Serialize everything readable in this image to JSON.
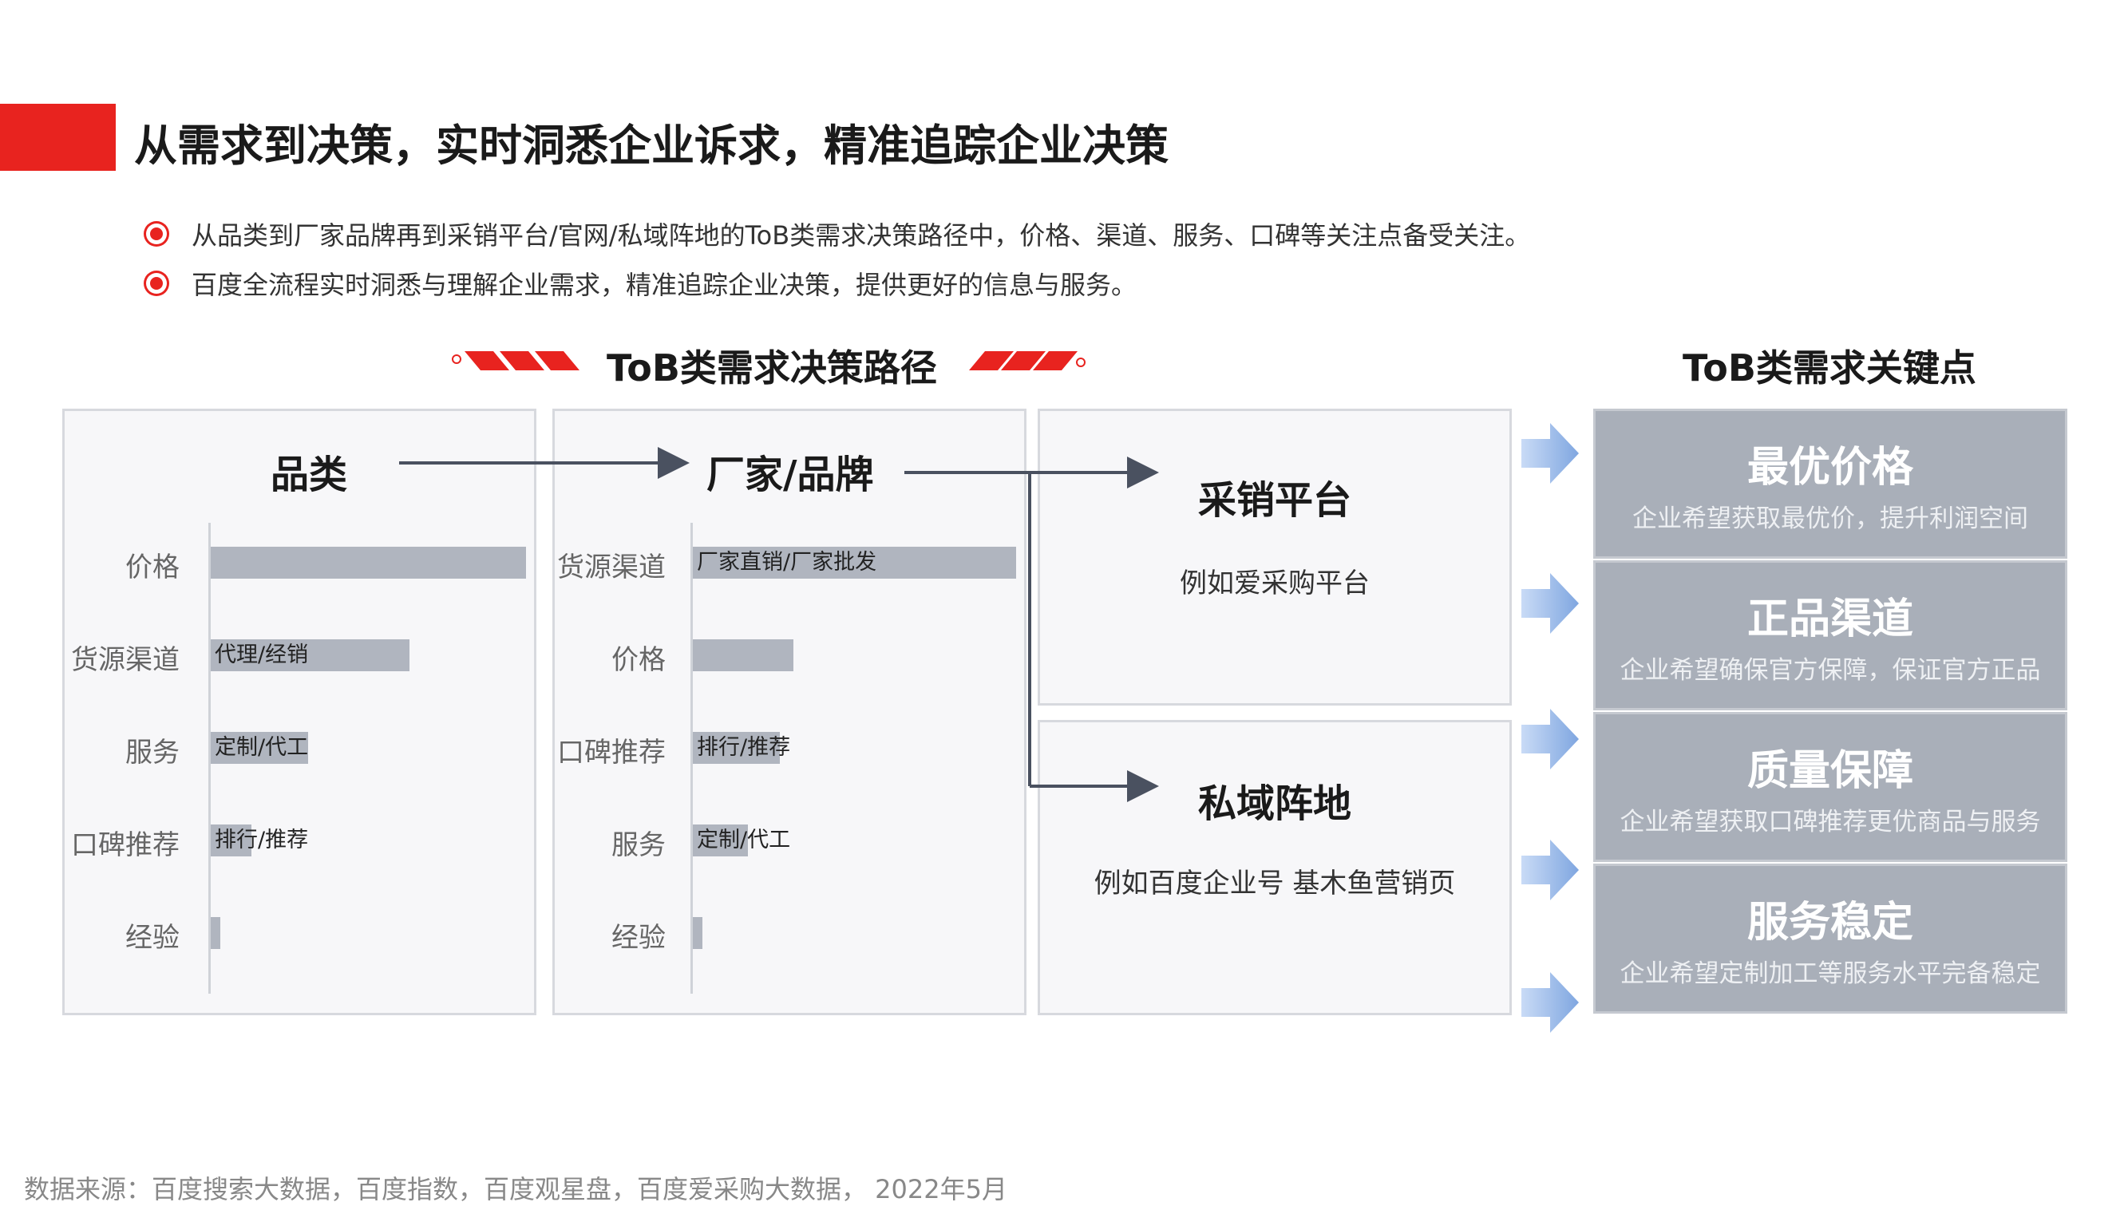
{
  "title": "从需求到决策，实时洞悉企业诉求，精准追踪企业决策",
  "bullets": [
    "从品类到厂家品牌再到采销平台/官网/私域阵地的ToB类需求决策路径中，价格、渠道、服务、口碑等关注点备受关注。",
    "百度全流程实时洞悉与理解企业需求，精准追踪企业决策，提供更好的信息与服务。"
  ],
  "path_title": "ToB类需求决策路径",
  "key_title": "ToB类需求关键点",
  "panel_category": {
    "title": "品类",
    "rows": [
      {
        "label": "价格",
        "bar_text": "",
        "value": 1.0
      },
      {
        "label": "货源渠道",
        "bar_text": "代理/经销",
        "value": 0.63
      },
      {
        "label": "服务",
        "bar_text": "定制/代工",
        "value": 0.31
      },
      {
        "label": "口碑推荐",
        "bar_text": "排行/推荐",
        "value": 0.13
      },
      {
        "label": "经验",
        "bar_text": "",
        "value": 0.03
      }
    ]
  },
  "panel_brand": {
    "title": "厂家/品牌",
    "rows": [
      {
        "label": "货源渠道",
        "bar_text": "厂家直销/厂家批发",
        "value": 1.0
      },
      {
        "label": "价格",
        "bar_text": "",
        "value": 0.31
      },
      {
        "label": "口碑推荐",
        "bar_text": "排行/推荐",
        "value": 0.27
      },
      {
        "label": "服务",
        "bar_text": "定制/代工",
        "value": 0.17
      },
      {
        "label": "经验",
        "bar_text": "",
        "value": 0.03
      }
    ]
  },
  "panel_platform": {
    "title": "采销平台",
    "subtitle": "例如爱采购平台"
  },
  "panel_private": {
    "title": "私域阵地",
    "subtitle": "例如百度企业号 基木鱼营销页"
  },
  "key_points": [
    {
      "title": "最优价格",
      "subtitle": "企业希望获取最优价，提升利润空间"
    },
    {
      "title": "正品渠道",
      "subtitle": "企业希望确保官方保障，保证官方正品"
    },
    {
      "title": "质量保障",
      "subtitle": "企业希望获取口碑推荐更优商品与服务"
    },
    {
      "title": "服务稳定",
      "subtitle": "企业希望定制加工等服务水平完备稳定"
    }
  ],
  "footer": "数据来源：百度搜索大数据，百度指数，百度观星盘，百度爱采购大数据， 2022年5月",
  "colors": {
    "accent": "#e8231f",
    "bar": "#b0b5bf",
    "key_bg": "#a9afb9",
    "arrow_blue": "#7fa6e0"
  }
}
